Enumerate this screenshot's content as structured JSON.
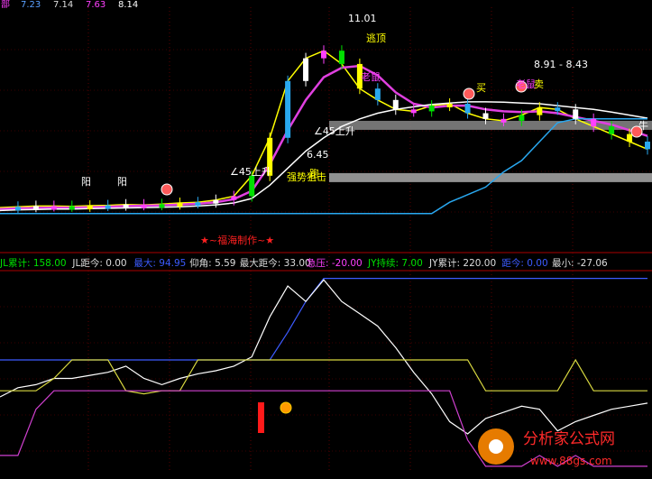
{
  "top_bar": [
    {
      "text": "部",
      "color": "#ff3fff"
    },
    {
      "text": "7.23",
      "color": "#5aa0ff"
    },
    {
      "text": "7.14",
      "color": "#dddddd"
    },
    {
      "text": "7.63",
      "color": "#ff3fff"
    },
    {
      "text": "8.14",
      "color": "#ffffff"
    }
  ],
  "price_annotations": [
    {
      "text": "11.01",
      "color": "#ffffff"
    },
    {
      "text": "8.91 - 8.43",
      "color": "#ffffff"
    },
    {
      "text": "∠45上升",
      "color": "#ffffff"
    },
    {
      "text": "∠45上升",
      "color": "#ffffff"
    },
    {
      "text": "6.45",
      "color": "#ffffff"
    },
    {
      "text": "老鼠",
      "color": "#ff3fff"
    },
    {
      "text": "老鼠",
      "color": "#ff3fff"
    },
    {
      "text": "阳",
      "color": "#ffffff"
    },
    {
      "text": "阳",
      "color": "#ffffff"
    },
    {
      "text": "强势狙击",
      "color": "#ffff00"
    },
    {
      "text": "跑",
      "color": "#ffff00"
    },
    {
      "text": "逃顶",
      "color": "#ffff00"
    },
    {
      "text": "买",
      "color": "#ffff00"
    },
    {
      "text": "卖",
      "color": "#ffff00"
    },
    {
      "text": "牛",
      "color": "#ffffff"
    }
  ],
  "credit_text": "★~福海制作~★",
  "indicator_bar": [
    {
      "text": "JL累计: 158.00",
      "color": "#00e000"
    },
    {
      "text": "JL距今: 0.00",
      "color": "#dddddd"
    },
    {
      "text": "最大: 94.95",
      "color": "#3c5bff"
    },
    {
      "text": "仰角: 5.59",
      "color": "#dddddd"
    },
    {
      "text": "最大距今: 33.00",
      "color": "#dddddd"
    },
    {
      "text": "急压: -20.00",
      "color": "#ff3fff"
    },
    {
      "text": "JY持续: 7.00",
      "color": "#00e000"
    },
    {
      "text": "JY累计: 220.00",
      "color": "#dddddd"
    },
    {
      "text": "距今: 0.00",
      "color": "#3c5bff"
    },
    {
      "text": "最小: -27.06",
      "color": "#dddddd"
    }
  ],
  "watermark": {
    "title": "分析家公式网",
    "url": "www.88gs.com"
  },
  "chart_data": {
    "type": "line",
    "title": "",
    "xlabel": "",
    "ylabel": "",
    "grid": true,
    "legend": "none",
    "panels": [
      {
        "name": "price",
        "ylim": [
          5.5,
          11.5
        ],
        "hlines": [
          {
            "value": 8.43,
            "color": "#888888"
          },
          {
            "value": 7.05,
            "color": "#aaaaaa"
          }
        ],
        "series": [
          {
            "color": "#ffff00",
            "values": [
              6.26,
              6.28,
              6.3,
              6.3,
              6.29,
              6.31,
              6.32,
              6.34,
              6.33,
              6.35,
              6.38,
              6.4,
              6.46,
              6.56,
              7.1,
              8.1,
              9.6,
              10.2,
              10.4,
              10.05,
              9.4,
              9.1,
              8.85,
              8.8,
              8.95,
              9.0,
              8.75,
              8.6,
              8.55,
              8.7,
              8.9,
              8.85,
              8.6,
              8.4,
              8.2,
              8.0,
              7.8
            ]
          },
          {
            "color": "#e040e0",
            "values": [
              6.22,
              6.24,
              6.25,
              6.26,
              6.26,
              6.27,
              6.28,
              6.3,
              6.31,
              6.32,
              6.34,
              6.36,
              6.4,
              6.48,
              6.7,
              7.4,
              8.3,
              9.1,
              9.7,
              9.95,
              10.0,
              9.75,
              9.3,
              9.0,
              8.9,
              8.95,
              8.95,
              8.85,
              8.8,
              8.78,
              8.8,
              8.75,
              8.65,
              8.55,
              8.45,
              8.3,
              8.15
            ]
          },
          {
            "color": "#ffffff",
            "values": [
              6.18,
              6.2,
              6.21,
              6.22,
              6.22,
              6.23,
              6.24,
              6.25,
              6.26,
              6.27,
              6.28,
              6.3,
              6.33,
              6.38,
              6.5,
              6.85,
              7.3,
              7.75,
              8.1,
              8.4,
              8.6,
              8.75,
              8.85,
              8.92,
              8.98,
              9.02,
              9.05,
              9.05,
              9.04,
              9.02,
              9.0,
              8.95,
              8.9,
              8.85,
              8.78,
              8.7,
              8.62
            ]
          },
          {
            "color": "#29a8f0",
            "values": [
              6.1,
              6.1,
              6.1,
              6.1,
              6.1,
              6.1,
              6.1,
              6.1,
              6.1,
              6.1,
              6.1,
              6.1,
              6.1,
              6.1,
              6.1,
              6.1,
              6.1,
              6.1,
              6.1,
              6.1,
              6.1,
              6.1,
              6.1,
              6.1,
              6.1,
              6.4,
              6.6,
              6.8,
              7.2,
              7.5,
              8.0,
              8.5,
              8.6,
              8.6,
              8.6,
              8.6,
              8.6
            ]
          }
        ]
      },
      {
        "name": "indicator",
        "ylim": [
          -30,
          100
        ],
        "series": [
          {
            "color": "#3c5bff",
            "values": [
              42,
              42,
              42,
              42,
              42,
              42,
              42,
              42,
              42,
              42,
              42,
              42,
              42,
              42,
              42,
              42,
              60,
              80,
              94.95,
              94.95,
              94.95,
              94.95,
              94.95,
              94.95,
              94.95,
              94.95,
              94.95,
              94.95,
              94.95,
              94.95,
              94.95,
              94.95,
              94.95,
              94.95,
              94.95,
              94.95,
              94.95
            ]
          },
          {
            "color": "#ffffff",
            "values": [
              18,
              24,
              26,
              30,
              30,
              32,
              34,
              38,
              30,
              26,
              30,
              33,
              35,
              38,
              44,
              70,
              90,
              80,
              94,
              80,
              72,
              64,
              50,
              34,
              20,
              2,
              -6,
              4,
              8,
              12,
              10,
              -4,
              2,
              6,
              10,
              12,
              14
            ]
          },
          {
            "color": "#d8d840",
            "values": [
              22,
              22,
              22,
              30,
              42,
              42,
              42,
              22,
              20,
              22,
              22,
              42,
              42,
              42,
              42,
              42,
              42,
              42,
              42,
              42,
              42,
              42,
              42,
              42,
              42,
              42,
              42,
              22,
              22,
              22,
              22,
              22,
              42,
              22,
              22,
              22,
              22
            ]
          },
          {
            "color": "#d040d0",
            "values": [
              -20,
              -20,
              10,
              22,
              22,
              22,
              22,
              22,
              22,
              22,
              22,
              22,
              22,
              22,
              22,
              22,
              22,
              22,
              22,
              22,
              22,
              22,
              22,
              22,
              22,
              22,
              -10,
              -27,
              -27,
              -27,
              -20,
              -27,
              -20,
              -27,
              -27,
              -27,
              -27
            ]
          }
        ]
      }
    ]
  }
}
